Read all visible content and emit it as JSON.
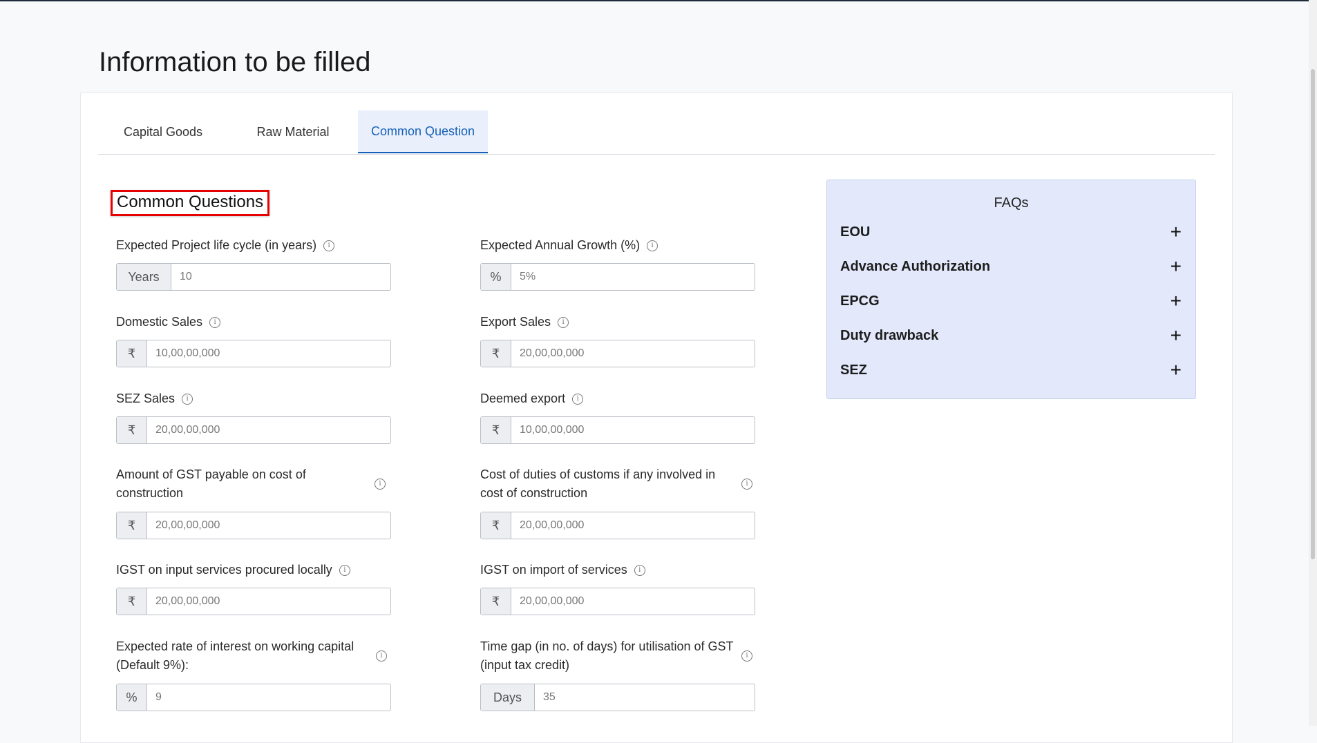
{
  "page": {
    "title": "Information to be filled"
  },
  "tabs": [
    {
      "label": "Capital Goods"
    },
    {
      "label": "Raw Material"
    },
    {
      "label": "Common Question"
    }
  ],
  "section": {
    "title": "Common Questions"
  },
  "fields": {
    "project_life": {
      "label": "Expected Project life cycle (in years)",
      "addon": "Years",
      "placeholder": "10"
    },
    "annual_growth": {
      "label": "Expected Annual Growth (%)",
      "addon": "%",
      "placeholder": "5%"
    },
    "domestic_sales": {
      "label": "Domestic Sales",
      "addon": "₹",
      "placeholder": "10,00,00,000"
    },
    "export_sales": {
      "label": "Export Sales",
      "addon": "₹",
      "placeholder": "20,00,00,000"
    },
    "sez_sales": {
      "label": "SEZ Sales",
      "addon": "₹",
      "placeholder": "20,00,00,000"
    },
    "deemed_export": {
      "label": "Deemed export",
      "addon": "₹",
      "placeholder": "10,00,00,000"
    },
    "gst_construction": {
      "label": "Amount of GST payable on cost of construction",
      "addon": "₹",
      "placeholder": "20,00,00,000"
    },
    "customs_construction": {
      "label": "Cost of duties of customs if any involved in cost of construction",
      "addon": "₹",
      "placeholder": "20,00,00,000"
    },
    "igst_local": {
      "label": "IGST on input services procured locally",
      "addon": "₹",
      "placeholder": "20,00,00,000"
    },
    "igst_import": {
      "label": "IGST on import of services",
      "addon": "₹",
      "placeholder": "20,00,00,000"
    },
    "interest_rate": {
      "label": "Expected rate of interest on working capital (Default 9%):",
      "addon": "%",
      "placeholder": "9"
    },
    "gst_time_gap": {
      "label": "Time gap (in no. of days) for utilisation of GST (input tax credit)",
      "addon": "Days",
      "placeholder": "35"
    }
  },
  "info_icon": "info-icon",
  "faq": {
    "title": "FAQs",
    "items": [
      {
        "label": "EOU",
        "icon": "plus-icon"
      },
      {
        "label": "Advance Authorization",
        "icon": "plus-icon"
      },
      {
        "label": "EPCG",
        "icon": "plus-icon"
      },
      {
        "label": "Duty drawback",
        "icon": "plus-icon"
      },
      {
        "label": "SEZ",
        "icon": "plus-icon"
      }
    ]
  },
  "colors": {
    "accent": "#1660b8",
    "faq_bg": "#e3e9fb",
    "highlight_border": "#e60000"
  }
}
